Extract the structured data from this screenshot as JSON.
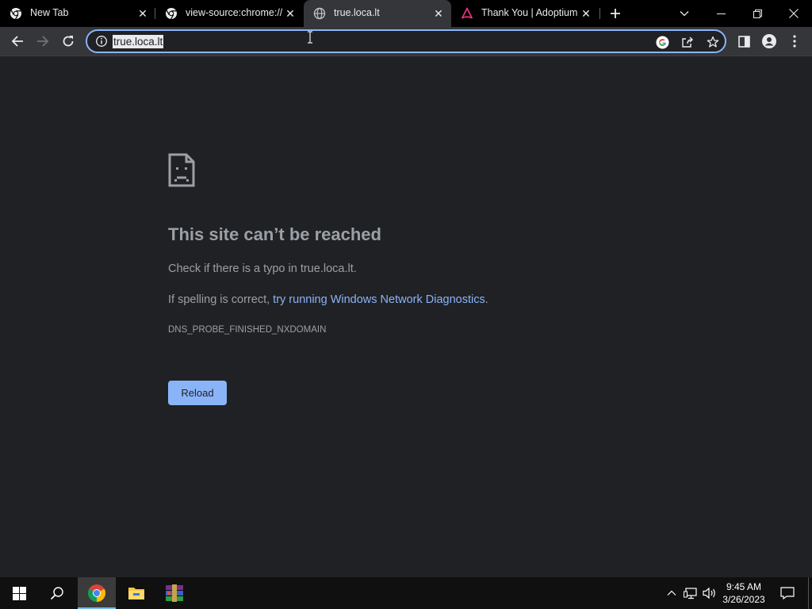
{
  "browser": {
    "tabs": [
      {
        "title": "New Tab",
        "icon": "chrome-icon"
      },
      {
        "title": "view-source:chrome://n",
        "icon": "chrome-icon"
      },
      {
        "title": "true.loca.lt",
        "icon": "globe-icon",
        "active": true
      },
      {
        "title": "Thank You | Adoptium",
        "icon": "adoptium-icon"
      }
    ],
    "address": "true.loca.lt",
    "accent_color": "#8ab4f8",
    "background_color": "#202124"
  },
  "error_page": {
    "title": "This site can’t be reached",
    "line1": "Check if there is a typo in true.loca.lt.",
    "line2_prefix": "If spelling is correct, ",
    "line2_link": "try running Windows Network Diagnostics",
    "line2_suffix": ".",
    "code": "DNS_PROBE_FINISHED_NXDOMAIN",
    "reload_label": "Reload",
    "icon": "sad-page-icon"
  },
  "taskbar": {
    "time": "9:45 AM",
    "date": "3/26/2023",
    "apps": [
      "chrome-icon",
      "file-explorer-icon",
      "winrar-icon"
    ]
  }
}
